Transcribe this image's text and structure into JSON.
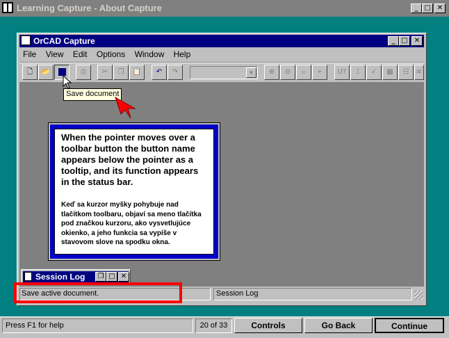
{
  "outer_window": {
    "title": "Learning Capture - About Capture"
  },
  "capture_window": {
    "title": "OrCAD Capture",
    "menu": [
      "File",
      "View",
      "Edit",
      "Options",
      "Window",
      "Help"
    ]
  },
  "tooltip": {
    "text": "Save document"
  },
  "info_box": {
    "text_en": "When the pointer moves over a toolbar button the button name appears below the pointer as a tooltip, and its function appears in the status bar.",
    "text_sk": "Keď sa kurzor myšky pohybuje nad tlačítkom toolbaru, objaví sa meno tlačítka pod značkou kurzoru, ako vysvetlujúce okienko, a jeho funkcia sa vypíše v stavovom slove na spodku okna."
  },
  "session_log": {
    "title": "Session Log"
  },
  "status_bar": {
    "left": "Save active document.",
    "right": "Session Log"
  },
  "bottom_bar": {
    "help": "Press F1 for help",
    "page": "20 of 33",
    "controls": "Controls",
    "back": "Go Back",
    "continue": "Continue"
  },
  "colors": {
    "accent_red": "#ff0000",
    "title_active": "#000080",
    "title_inactive": "#808080",
    "teal": "#008080"
  }
}
